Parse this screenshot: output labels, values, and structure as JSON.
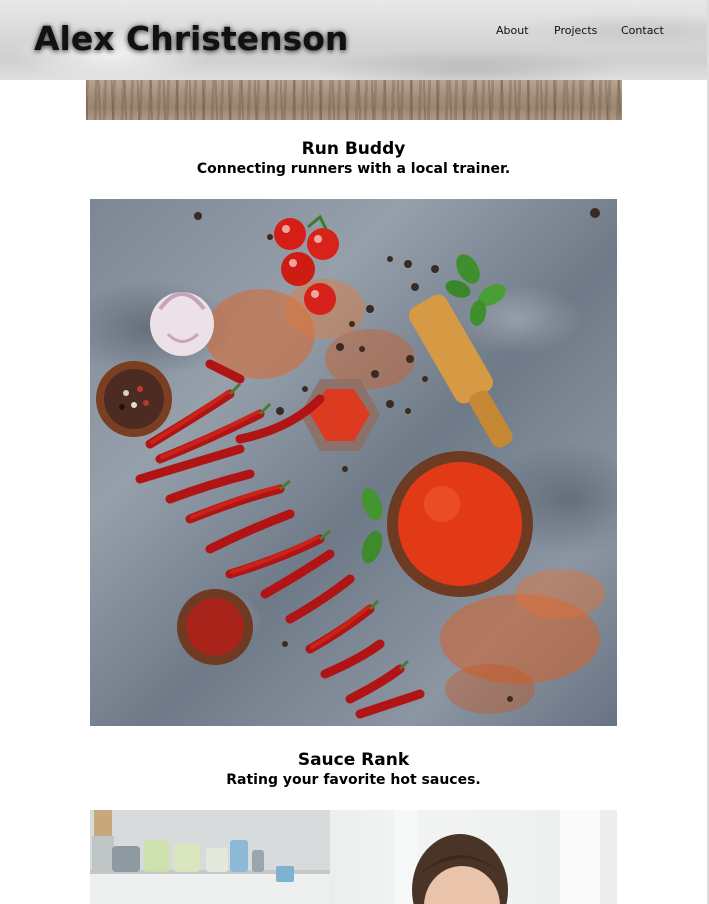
{
  "site": {
    "title": "Alex Christenson"
  },
  "nav": {
    "items": [
      {
        "label": "About"
      },
      {
        "label": "Projects"
      },
      {
        "label": "Contact"
      }
    ]
  },
  "projects": [
    {
      "title": "Run Buddy",
      "subtitle": "Connecting runners with a local trainer.",
      "image": "spices-hot-sauce-photo"
    },
    {
      "title": "Sauce Rank",
      "subtitle": "Rating your favorite hot sauces.",
      "image": "woman-kitchen-photo"
    }
  ],
  "colors": {
    "text": "#000000",
    "page_background": "#ffffff"
  }
}
